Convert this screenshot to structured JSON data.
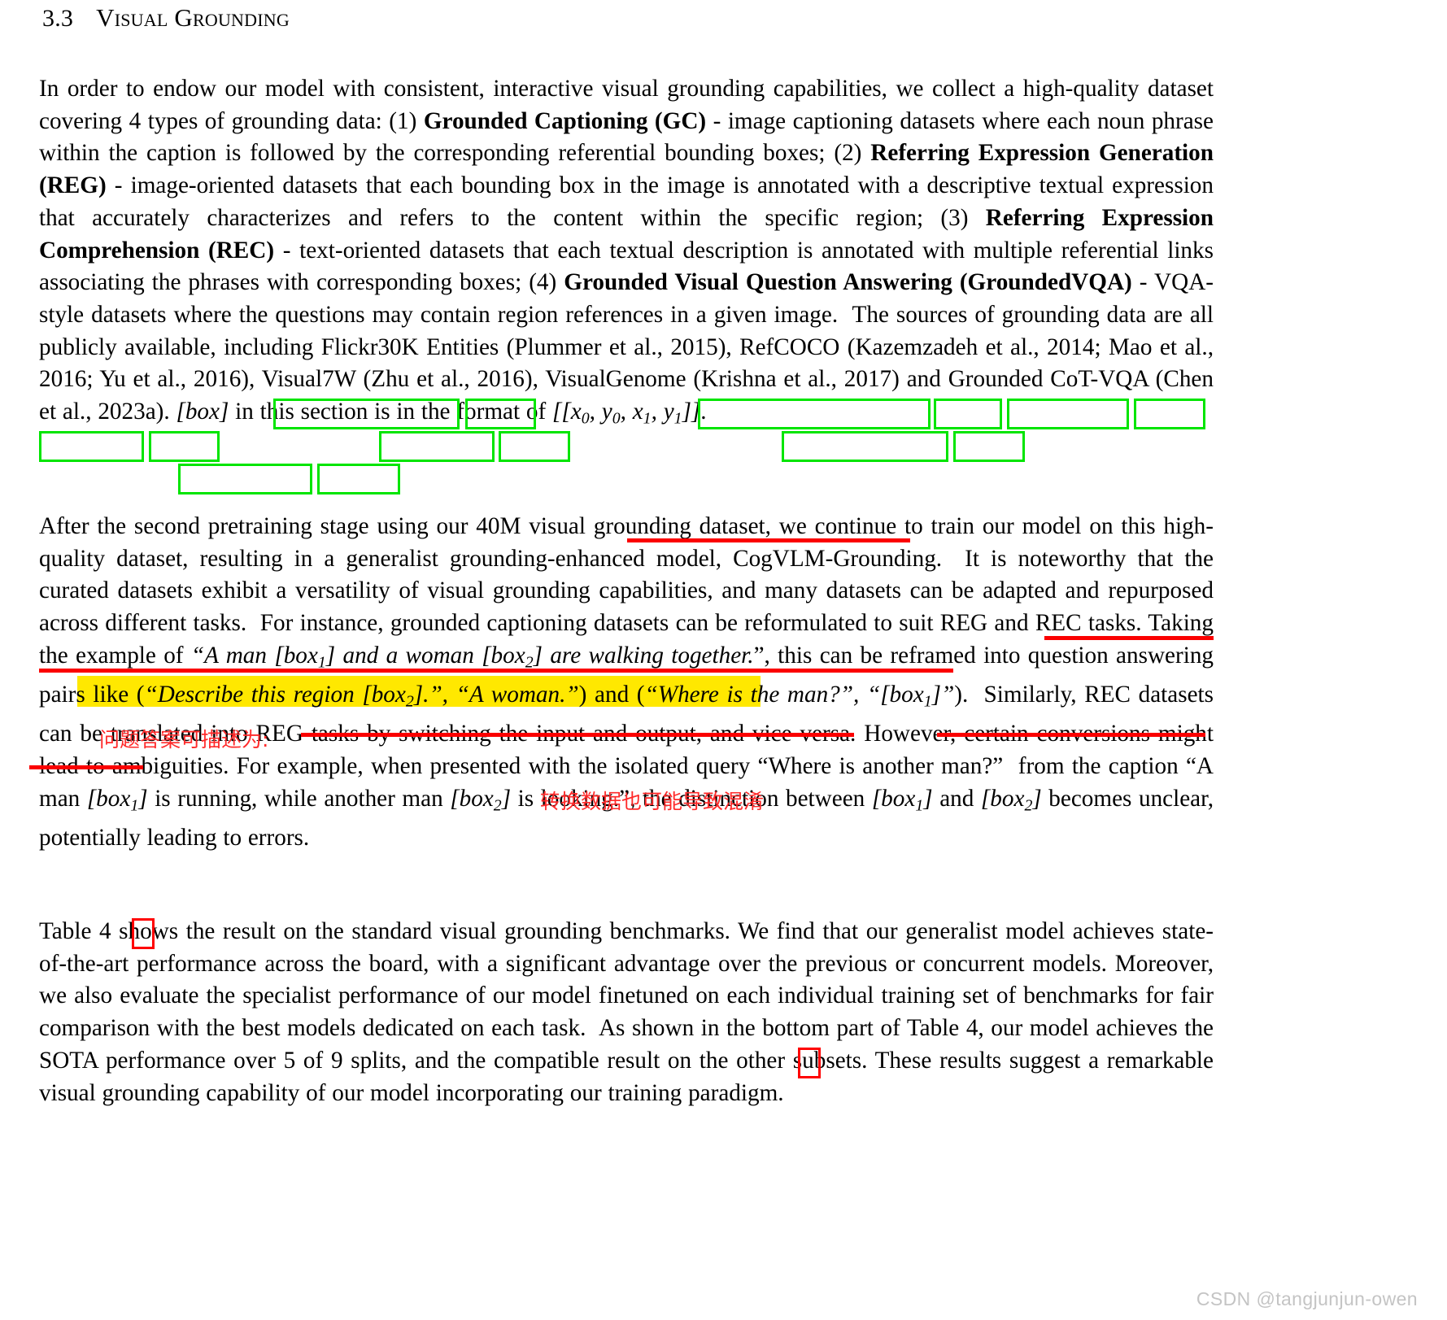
{
  "heading": {
    "number": "3.3",
    "title": "Visual Grounding"
  },
  "paragraphs": {
    "p1_text": "In order to endow our model with consistent, interactive visual grounding capabilities, we collect a high-quality dataset covering 4 types of grounding data: (1) Grounded Captioning (GC) - image captioning datasets where each noun phrase within the caption is followed by the corresponding referential bounding boxes; (2) Referring Expression Generation (REG) - image-oriented datasets that each bounding box in the image is annotated with a descriptive textual expression that accurately characterizes and refers to the content within the specific region; (3) Referring Expression Comprehension (REC) - text-oriented datasets that each textual description is annotated with multiple referential links associating the phrases with corresponding boxes; (4) Grounded Visual Question Answering (GroundedVQA) - VQA-style datasets where the questions may contain region references in a given image. The sources of grounding data are all publicly available, including Flickr30K Entities (Plummer et al., 2015), RefCOCO (Kazemzadeh et al., 2014; Mao et al., 2016; Yu et al., 2016), Visual7W (Zhu et al., 2016), VisualGenome (Krishna et al., 2017) and Grounded CoT-VQA (Chen et al., 2023a). [box] in this section is in the format of [[x0, y0, x1, y1]].",
    "p2_text": "After the second pretraining stage using our 40M visual grounding dataset, we continue to train our model on this high-quality dataset, resulting in a generalist grounding-enhanced model, CogVLM-Grounding. It is noteworthy that the curated datasets exhibit a versatility of visual grounding capabilities, and many datasets can be adapted and repurposed across different tasks. For instance, grounded captioning datasets can be reformulated to suit REG and REC tasks. Taking the example of \"A man [box1] and a woman [box2] are walking together.\", this can be reframed into question answering pairs like (\"Describe this region [box2].\", \"A woman.\") and (\"Where is the man?\", \"[box1]\"). Similarly, REC datasets can be translated into REG tasks by switching the input and output, and vice versa. However, certain conversions might lead to ambiguities. For example, when presented with the isolated query \"Where is another man?\" from the caption \"A man [box1] is running, while another man [box2] is looking.\", the distinction between [box1] and [box2] becomes unclear, potentially leading to errors.",
    "p3_text": "Table 4 shows the result on the standard visual grounding benchmarks. We find that our generalist model achieves state-of-the-art performance across the board, with a significant advantage over the previous or concurrent models. Moreover, we also evaluate the specialist performance of our model finetuned on each individual training set of benchmarks for fair comparison with the best models dedicated on each task. As shown in the bottom part of Table 4, our model achieves the SOTA performance over 5 of 9 splits, and the compatible result on the other subsets. These results suggest a remarkable visual grounding capability of our model incorporating our training paradigm."
  },
  "annotations": {
    "green_box_color": "#00e500",
    "red_box_color": "#ff0000",
    "red_underline_color": "#fb0000",
    "highlight_color": "#ffe800",
    "chinese_note_1": "问题答案可描述为:",
    "chinese_note_2": "转换数据也可能导致混淆",
    "boxed_citations": [
      "Plummer et al.,",
      "2015",
      "Kazemzadeh et al.,",
      "2014",
      "Mao et al.,",
      "2016",
      "Yu et al.,",
      "2016",
      "Zhu et al.,",
      "2016",
      "Krishna et al.,",
      "2017",
      "Chen et al.,",
      "2023a"
    ],
    "boxed_table_refs": [
      "4",
      "4"
    ],
    "highlighted_phrase": "\"A man [box1] and a woman [box2] are walking together.\"",
    "underlined_phrases": [
      "visual grounding dataset",
      "For instance, grounded captioning datasets can be reformulated to suit REG and REC tasks",
      "(\"Describe this region [box2].\", \"A woman.\")",
      "(\"Where is the man?\", \"[box1]\")"
    ]
  },
  "watermark": {
    "text": "CSDN @tangjunjun-owen"
  }
}
